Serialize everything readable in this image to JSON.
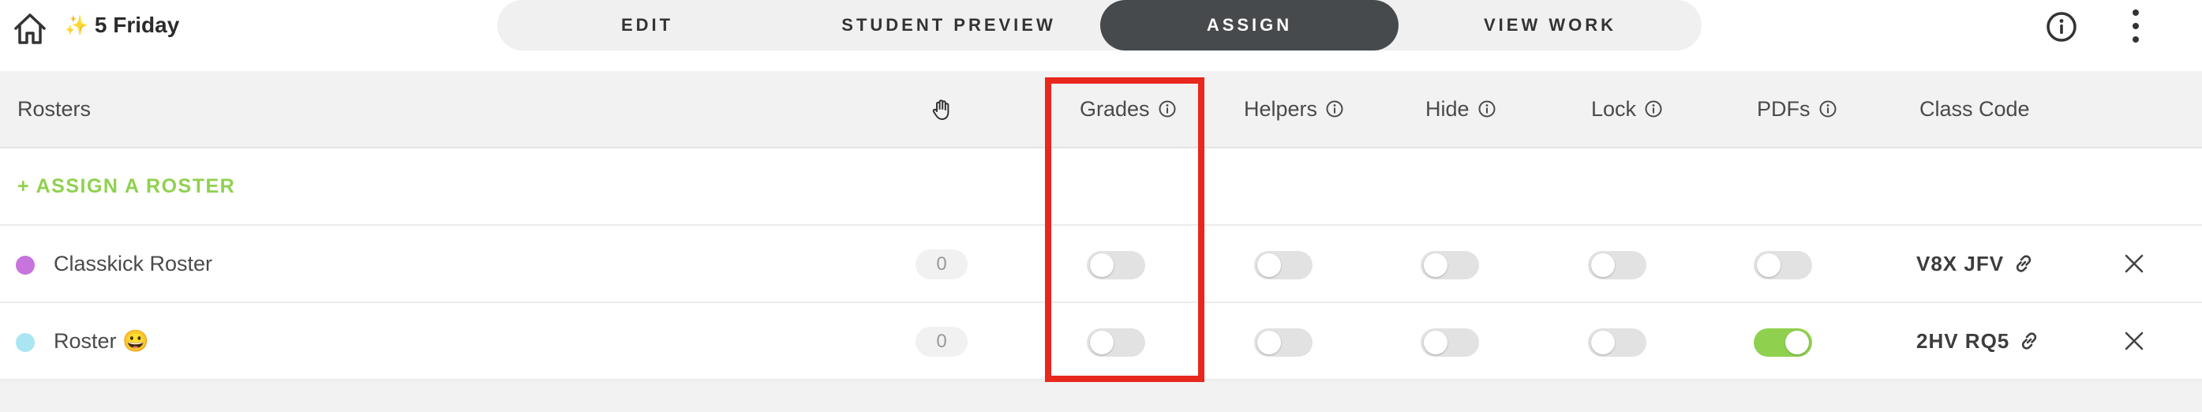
{
  "topbar": {
    "title_emoji": "✨",
    "title": "5 Friday",
    "tabs": [
      {
        "label": "EDIT",
        "active": false
      },
      {
        "label": "STUDENT PREVIEW",
        "active": false
      },
      {
        "label": "ASSIGN",
        "active": true
      },
      {
        "label": "VIEW WORK",
        "active": false
      }
    ],
    "icons": [
      "home-icon",
      "sparkle-icon",
      "info-icon",
      "more-vertical-icon"
    ]
  },
  "table": {
    "headers": {
      "rosters": "Rosters",
      "hand_icon": "raise-hand-icon",
      "grades": "Grades",
      "helpers": "Helpers",
      "hide": "Hide",
      "lock": "Lock",
      "pdfs": "PDFs",
      "class_code": "Class Code"
    },
    "assign_roster_label": "+ ASSIGN A ROSTER",
    "rows": [
      {
        "color": "#c874dd",
        "name": "Classkick Roster",
        "count": "0",
        "grades": false,
        "helpers": false,
        "hide": false,
        "lock": false,
        "pdfs": false,
        "class_code": "V8X JFV"
      },
      {
        "color": "#a9e6f2",
        "name": "Roster 😀",
        "count": "0",
        "grades": false,
        "helpers": false,
        "hide": false,
        "lock": false,
        "pdfs": true,
        "class_code": "2HV RQ5"
      }
    ]
  },
  "colors": {
    "accent_green": "#8fd14f",
    "active_tab": "#474a4d",
    "highlight_red": "#e8271d"
  }
}
